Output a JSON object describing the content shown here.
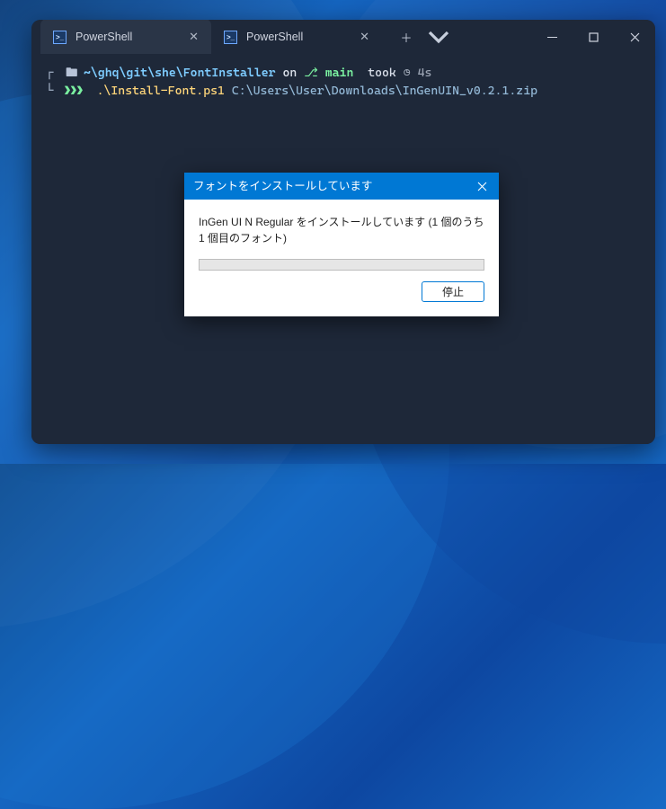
{
  "tabs": [
    {
      "label": "PowerShell"
    },
    {
      "label": "PowerShell"
    }
  ],
  "prompt": {
    "path": "~\\ghq\\git\\she\\FontInstaller",
    "on_word": "on",
    "branch_icon": "⎇",
    "branch": "main",
    "took_word": "took",
    "clock_icon": "◷",
    "duration": "4s",
    "chevrons": "❯❯❯",
    "script": ".\\Install-Font.ps1",
    "arg": "C:\\Users\\User\\Downloads\\InGenUIN_v0.2.1.zip"
  },
  "dialog": {
    "title": "フォントをインストールしています",
    "message": "InGen UI N Regular をインストールしています (1 個のうち 1 個目のフォント)",
    "stop_label": "停止"
  }
}
